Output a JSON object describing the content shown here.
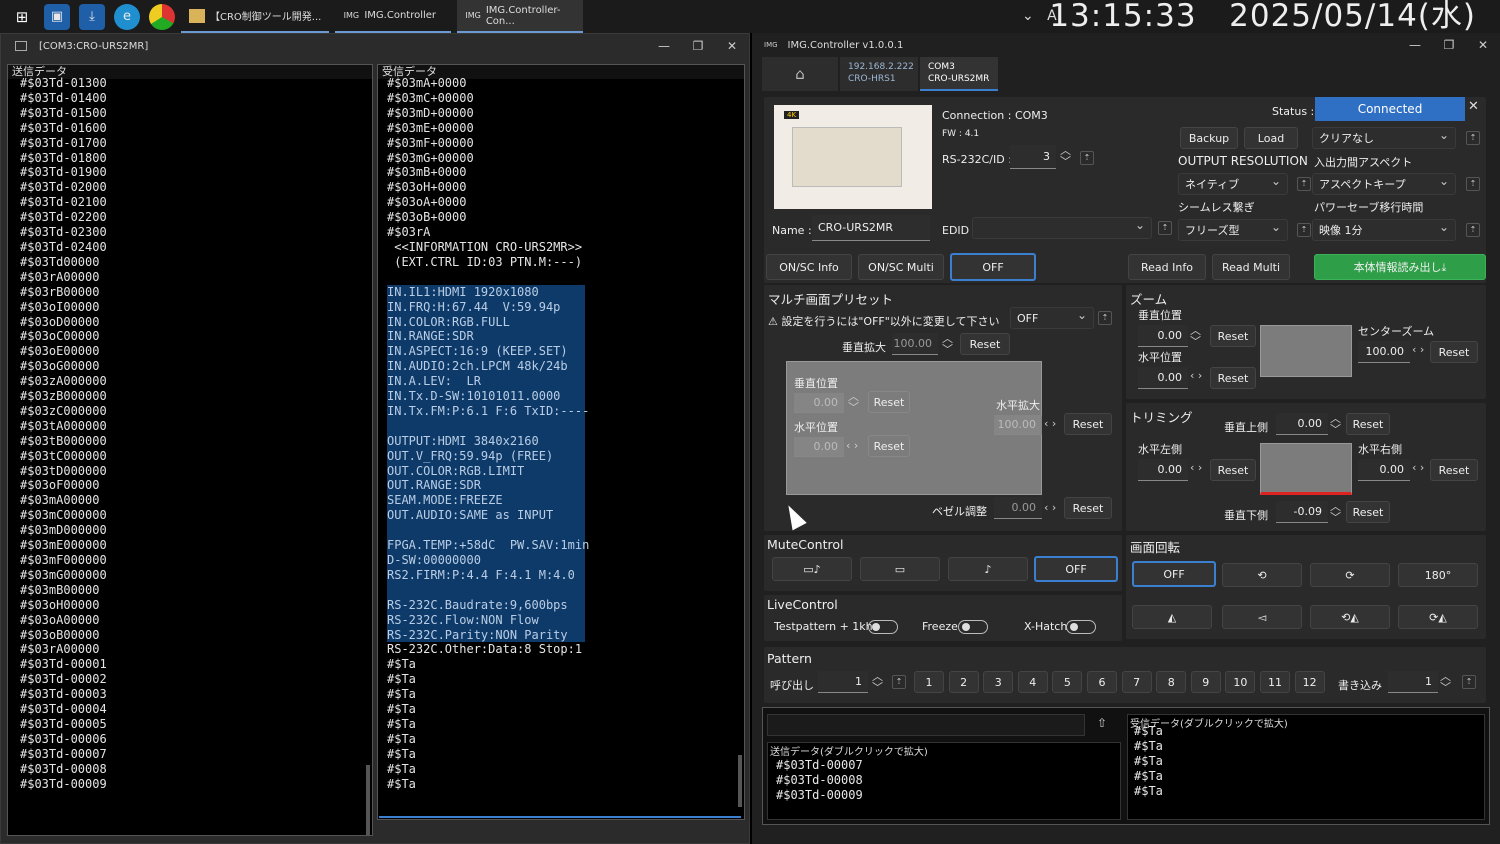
{
  "taskbar": {
    "apps": [
      {
        "label": "【CRO制御ツール開発..."
      },
      {
        "label": "IMG.Controller"
      },
      {
        "label": "IMG.Controller-Con..."
      }
    ],
    "ime": "A",
    "time": "13:15:33",
    "date": "2025/05/14(水)"
  },
  "terminal": {
    "title": "[COM3:CRO-URS2MR]",
    "send_header": "送信データ",
    "recv_header": "受信データ",
    "send_lines": [
      "#$03Td-01300",
      "#$03Td-01400",
      "#$03Td-01500",
      "#$03Td-01600",
      "#$03Td-01700",
      "#$03Td-01800",
      "#$03Td-01900",
      "#$03Td-02000",
      "#$03Td-02100",
      "#$03Td-02200",
      "#$03Td-02300",
      "#$03Td-02400",
      "#$03Td00000",
      "#$03rA00000",
      "#$03rB00000",
      "#$03oI00000",
      "#$03oD00000",
      "#$03oC00000",
      "#$03oE00000",
      "#$03oG00000",
      "#$03zA000000",
      "#$03zB000000",
      "#$03zC000000",
      "#$03tA000000",
      "#$03tB000000",
      "#$03tC000000",
      "#$03tD000000",
      "#$03oF00000",
      "#$03mA00000",
      "#$03mC000000",
      "#$03mD000000",
      "#$03mE000000",
      "#$03mF000000",
      "#$03mG000000",
      "#$03mB00000",
      "#$03oH00000",
      "#$03oA00000",
      "#$03oB00000",
      "#$03rA00000",
      "#$03Td-00001",
      "#$03Td-00002",
      "#$03Td-00003",
      "#$03Td-00004",
      "#$03Td-00005",
      "#$03Td-00006",
      "#$03Td-00007",
      "#$03Td-00008",
      "#$03Td-00009"
    ],
    "recv_lines": [
      "#$03mA+0000",
      "#$03mC+00000",
      "#$03mD+00000",
      "#$03mE+00000",
      "#$03mF+00000",
      "#$03mG+00000",
      "#$03mB+0000",
      "#$03oH+0000",
      "#$03oA+0000",
      "#$03oB+0000",
      "#$03rA",
      " <<INFORMATION CRO-URS2MR>>",
      " (EXT.CTRL ID:03 PTN.M:---)",
      ""
    ],
    "recv_hl": [
      "IN.IL1:HDMI 1920x1080",
      "IN.FRQ:H:67.44  V:59.94p",
      "IN.COLOR:RGB.FULL",
      "IN.RANGE:SDR",
      "IN.ASPECT:16:9 (KEEP.SET)",
      "IN.AUDIO:2ch.LPCM 48k/24b",
      "IN.A.LEV:  LR",
      "IN.Tx.D-SW:10101011.0000",
      "IN.Tx.FM:P:6.1 F:6 TxID:----",
      "",
      "OUTPUT:HDMI 3840x2160",
      "OUT.V_FRQ:59.94p (FREE)",
      "OUT.COLOR:RGB.LIMIT",
      "OUT.RANGE:SDR",
      "SEAM.MODE:FREEZE",
      "OUT.AUDIO:SAME as INPUT",
      "",
      "FPGA.TEMP:+58dC  PW.SAV:1min",
      "D-SW:00000000",
      "RS2.FIRM:P:4.4 F:4.1 M:4.0",
      "",
      "RS-232C.Baudrate:9,600bps",
      "RS-232C.Flow:NON Flow",
      "RS-232C.Parity:NON Parity"
    ],
    "recv_tail": [
      "RS-232C.Other:Data:8 Stop:1",
      "#$Ta",
      "#$Ta",
      "#$Ta",
      "#$Ta",
      "#$Ta",
      "#$Ta",
      "#$Ta",
      "#$Ta",
      "#$Ta"
    ]
  },
  "app": {
    "title": "IMG.Controller v1.0.0.1",
    "tabs": [
      {
        "l1": "192.168.2.222",
        "l2": "CRO-HRS1"
      },
      {
        "l1": "COM3",
        "l2": "CRO-URS2MR"
      }
    ],
    "device": {
      "connection": "Connection : COM3",
      "fw": "FW : 4.1",
      "rs232_label": "RS-232C/ID :",
      "rs232_id": "3",
      "name_label": "Name :",
      "name_value": "CRO-URS2MR",
      "edid_label": "EDID :",
      "status_label": "Status :",
      "status_value": "Connected",
      "backup": "Backup",
      "load": "Load",
      "clear": "クリアなし",
      "out_res_label": "OUTPUT RESOLUTION",
      "aspect_label": "入出力間アスペクト",
      "out_res_value": "ネイティブ",
      "aspect_value": "アスペクトキープ",
      "seamless_label": "シームレス繋ぎ",
      "power_label": "パワーセーブ移行時間",
      "seamless_value": "フリーズ型",
      "power_value": "映像 1分"
    },
    "info_buttons": {
      "onsc_info": "ON/SC Info",
      "onsc_multi": "ON/SC Multi",
      "off": "OFF",
      "read_info": "Read Info",
      "read_multi": "Read Multi",
      "read_all": "本体情報読み出し⤓"
    },
    "multi": {
      "title": "マルチ画面プリセット",
      "warn": "⚠ 設定を行うには\"OFF\"以外に変更して下さい",
      "preset": "OFF",
      "v_zoom_label": "垂直拡大",
      "v_zoom": "100.00",
      "reset": "Reset",
      "v_pos_label": "垂直位置",
      "v_pos": "0.00",
      "h_pos_label": "水平位置",
      "h_pos": "0.00",
      "h_zoom_label": "水平拡大",
      "h_zoom": "100.00",
      "bezel_label": "ベゼル調整",
      "bezel": "0.00"
    },
    "zoom": {
      "title": "ズーム",
      "v_label": "垂直位置",
      "v": "0.00",
      "h_label": "水平位置",
      "h": "0.00",
      "center_label": "センターズーム",
      "center": "100.00"
    },
    "trim": {
      "title": "トリミング",
      "top_label": "垂直上側",
      "top": "0.00",
      "left_label": "水平左側",
      "left": "0.00",
      "right_label": "水平右側",
      "right": "0.00",
      "bottom_label": "垂直下側",
      "bottom": "-0.09"
    },
    "mute": {
      "title": "MuteControl",
      "off": "OFF"
    },
    "rotate": {
      "title": "画面回転",
      "off": "OFF",
      "r180": "180°"
    },
    "live": {
      "title": "LiveControl",
      "testpattern": "Testpattern + 1khz",
      "freeze": "Freeze",
      "xhatch": "X-Hatch"
    },
    "pattern": {
      "title": "Pattern",
      "call_label": "呼び出し",
      "call": "1",
      "nums": [
        "1",
        "2",
        "3",
        "4",
        "5",
        "6",
        "7",
        "8",
        "9",
        "10",
        "11",
        "12"
      ],
      "write_label": "書き込み",
      "write": "1"
    },
    "log": {
      "send_label": "送信データ(ダブルクリックで拡大)",
      "send": [
        "#$03Td-00007",
        "#$03Td-00008",
        "#$03Td-00009"
      ],
      "recv_label": "受信データ(ダブルクリックで拡大)",
      "recv": [
        "#$Ta",
        "#$Ta",
        "#$Ta",
        "#$Ta",
        "#$Ta"
      ]
    }
  },
  "colors": {
    "accent": "#2f6fc4",
    "green": "#2f9e48",
    "highlight": "#0e3a6a"
  }
}
